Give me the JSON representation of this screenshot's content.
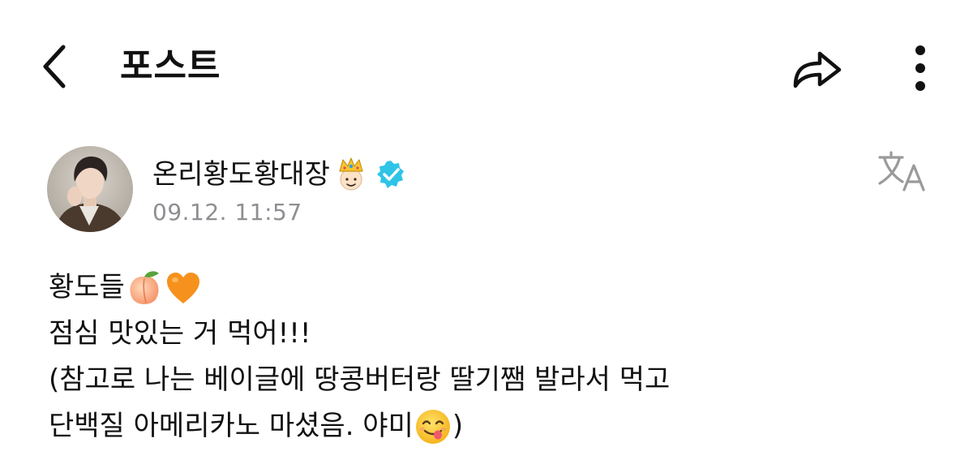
{
  "header": {
    "title": "포스트",
    "back_icon": "chevron-left-icon",
    "share_icon": "share-arrow-icon",
    "more_icon": "more-vertical-icon"
  },
  "author": {
    "name": "온리황도황대장",
    "badge_emoji": "crown-face-emoji",
    "verified_color": "#2ec4e8",
    "timestamp": "09.12. 11:57",
    "translate_icon": "translate-icon"
  },
  "post": {
    "lines": [
      {
        "text": "황도들",
        "emojis": [
          "peach-emoji",
          "orange-heart-emoji"
        ]
      },
      {
        "text": "점심 맛있는 거 먹어!!!"
      },
      {
        "text": "(참고로 나는 베이글에 땅콩버터랑 딸기쨈 발라서 먹고"
      },
      {
        "text": "단백질 아메리카노 마셨음. 야미",
        "trailing_emoji": "yum-face-emoji",
        "trailing_text": ")"
      }
    ]
  }
}
